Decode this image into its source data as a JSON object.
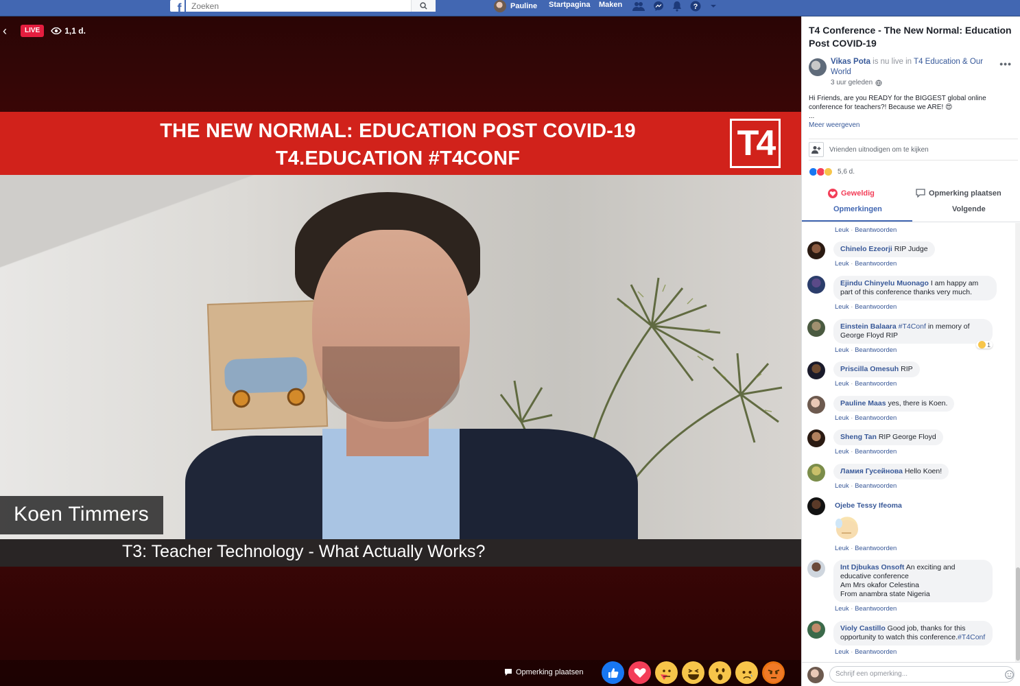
{
  "topbar": {
    "search_placeholder": "Zoeken",
    "user_name": "Pauline",
    "home_label": "Startpagina",
    "create_label": "Maken"
  },
  "video": {
    "live_label": "LIVE",
    "viewer_count": "1,1 d.",
    "banner_line1": "THE NEW NORMAL: EDUCATION POST COVID-19",
    "banner_line2": "T4.EDUCATION #T4CONF",
    "logo_text": "T4",
    "speaker_name": "Koen Timmers",
    "session_title": "T3: Teacher Technology - What Actually Works?",
    "comment_button": "Opmerking plaatsen",
    "reactions": [
      "like",
      "love",
      "care",
      "haha",
      "wow",
      "sad",
      "angry"
    ]
  },
  "panel": {
    "title": "T4 Conference - The New Normal: Education Post COVID-19",
    "poster_name": "Vikas Pota",
    "poster_action": " is nu live in ",
    "poster_group": "T4 Education & Our World",
    "post_time": "3 uur geleden",
    "post_text": "Hi Friends, are you READY for the BIGGEST global online conference for teachers?! Because we ARE! 😍",
    "post_ellipsis": "...",
    "see_more": "Meer weergeven",
    "invite_text": "Vrienden uitnodigen om te kijken",
    "reaction_count": "5,6 d.",
    "love_action": "Geweldig",
    "comment_action": "Opmerking plaatsen",
    "tab_comments": "Opmerkingen",
    "tab_following": "Volgende",
    "comment_placeholder": "Schrijf een opmerking..."
  },
  "comment_actions": {
    "like": "Leuk",
    "reply": "Beantwoorden",
    "sep": " · "
  },
  "comments": [
    {
      "name": "Chinelo Ezeorji",
      "text": "RIP Judge"
    },
    {
      "name": "Ejindu Chinyelu Muonago",
      "text": "I am happy am part of this conference thanks very much."
    },
    {
      "name": "Einstein Balaara",
      "tag": "#T4Conf",
      "text": "in memory of George Floyd RIP",
      "reaction_count": "1"
    },
    {
      "name": "Priscilla Omesuh",
      "text": "RIP"
    },
    {
      "name": "Pauline Maas",
      "text": "yes, there is Koen."
    },
    {
      "name": "Sheng Tan",
      "text": "RIP George Floyd"
    },
    {
      "name": "Ламия Гусейнова",
      "text": "Hello Koen!"
    },
    {
      "name": "Ojebe Tessy Ifeoma",
      "text": ""
    },
    {
      "name": "Int Djbukas Onsoft",
      "text": "An exciting and educative conference\nAm Mrs okafor Celestina\nFrom anambra state Nigeria"
    },
    {
      "name": "Violy Castillo",
      "text": "Good job, thanks for this opportunity to watch this conference.",
      "tag": "#T4Conf"
    }
  ],
  "colors": {
    "facebook_blue": "#4267b2",
    "live_red": "#e41e3f",
    "banner_red": "#d1221b",
    "link_blue": "#385898"
  }
}
